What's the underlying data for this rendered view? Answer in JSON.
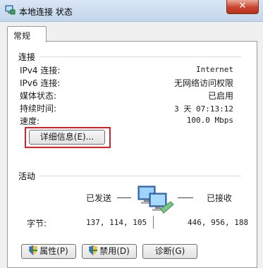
{
  "window": {
    "title": "本地连接 状态",
    "close_label": "✕"
  },
  "tabs": [
    {
      "label": "常规"
    }
  ],
  "connection": {
    "heading": "连接",
    "rows": [
      {
        "label": "IPv4 连接:",
        "value": "Internet"
      },
      {
        "label": "IPv6 连接:",
        "value": "无网络访问权限"
      },
      {
        "label": "媒体状态:",
        "value": "已启用"
      },
      {
        "label": "持续时间:",
        "value": "3 天 07:13:12"
      },
      {
        "label": "速度:",
        "value": "100.0 Mbps"
      }
    ],
    "details_button": "详细信息(E)..."
  },
  "activity": {
    "heading": "活动",
    "sent_label": "已发送",
    "received_label": "已接收",
    "bytes_label": "字节:",
    "bytes_sent": "137, 114, 105",
    "bytes_received": "446, 956, 188"
  },
  "buttons": {
    "properties": "属性(P)",
    "disable": "禁用(D)",
    "diagnose": "诊断(G)"
  },
  "colors": {
    "highlight": "#e02020",
    "titlebar": "#c3d6ec"
  }
}
